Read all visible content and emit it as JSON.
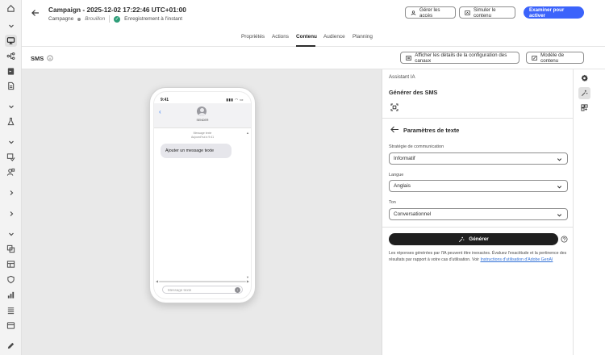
{
  "header": {
    "title": "Campaign - 2025-12-02 17:22:46 UTC+01:00",
    "type_label": "Campagne",
    "status": "Brouillon",
    "autosave": "Enregistrement à l'instant",
    "manage_access": "Gérer les accès",
    "simulate": "Simuler le contenu",
    "review": "Examiner pour activer"
  },
  "tabs": [
    "Propriétés",
    "Actions",
    "Contenu",
    "Audience",
    "Planning"
  ],
  "active_tab": "Contenu",
  "toolbar": {
    "channel": "SMS",
    "show_config": "Afficher les détails de la configuration des canaux",
    "template": "Modèle de contenu"
  },
  "phone": {
    "time": "9:41",
    "sender": "SENDER",
    "meta_line1": "Message texte",
    "meta_line2": "Aujourd'hui à 9:41",
    "bubble": "Ajouter un message texte",
    "input_placeholder": "Message texte"
  },
  "assistant": {
    "section": "Assistant IA",
    "title": "Générer des SMS",
    "params_title": "Paramètres de texte",
    "strategy_label": "Stratégie de communication",
    "strategy_value": "Informatif",
    "language_label": "Langue",
    "language_value": "Anglais",
    "tone_label": "Ton",
    "tone_value": "Conversationnel",
    "generate": "Générer",
    "disclaimer_text": "Les réponses générées par l'IA peuvent être inexactes. Évaluez l'exactitude et la pertinence des résultats par rapport à votre cas d'utilisation. Voir ",
    "disclaimer_link": "Instructions d'utilisation d'Adobe GenAI"
  },
  "icons": {
    "left_rail": [
      "home-icon",
      "chevron-down-icon",
      "campaign-icon",
      "journey-icon",
      "channel-icon",
      "document-icon",
      "chevron-down-icon",
      "flask-icon",
      "chevron-down-icon",
      "fragment-icon",
      "audience-icon",
      "chevron-right-icon",
      "chevron-right-icon",
      "chevron-down-icon",
      "templates-icon",
      "table-icon",
      "shield-icon",
      "report-icon",
      "list-icon",
      "data-icon",
      "pencil-icon"
    ],
    "right_rail": [
      "settings-icon",
      "ai-magic-icon",
      "variants-icon"
    ]
  },
  "colors": {
    "primary": "#3b63fb",
    "dark_button": "#1f1f1f",
    "canvas_bg": "#e9e9e9",
    "success": "#2d9d78"
  }
}
